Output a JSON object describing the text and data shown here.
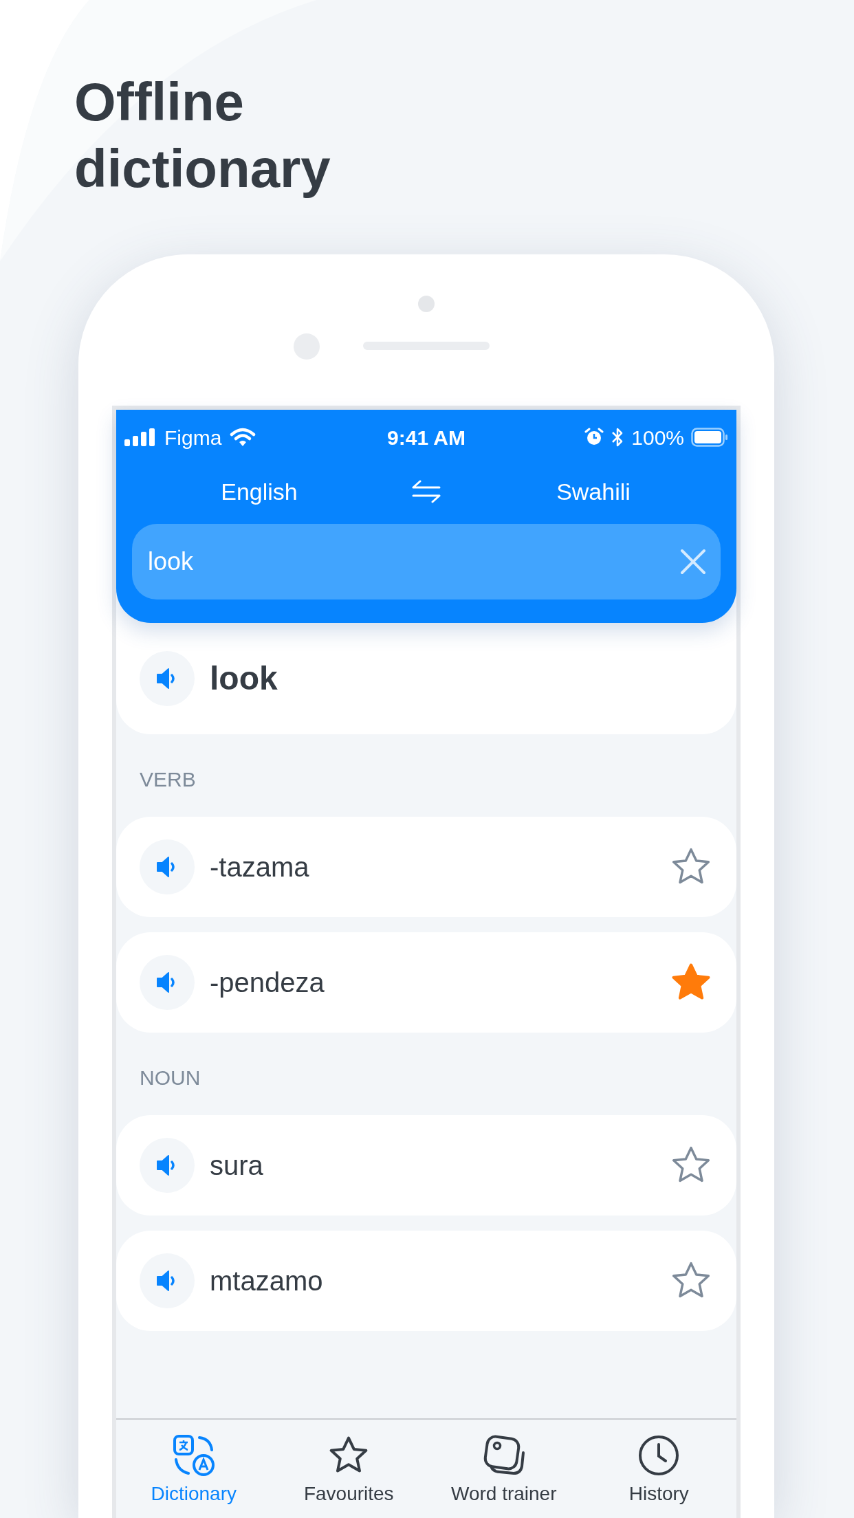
{
  "heading": "Offline dictionary",
  "status_bar": {
    "carrier": "Figma",
    "time": "9:41 AM",
    "battery": "100%"
  },
  "languages": {
    "source": "English",
    "target": "Swahili"
  },
  "search": {
    "value": "look"
  },
  "headword": "look",
  "sections": [
    {
      "title": "VERB",
      "entries": [
        {
          "word": "-tazama",
          "favourite": false
        },
        {
          "word": "-pendeza",
          "favourite": true
        }
      ]
    },
    {
      "title": "NOUN",
      "entries": [
        {
          "word": "sura",
          "favourite": false
        },
        {
          "word": "mtazamo",
          "favourite": false
        }
      ]
    }
  ],
  "tabs": [
    {
      "label": "Dictionary",
      "kind": "dictionary",
      "selected": true
    },
    {
      "label": "Favourites",
      "kind": "favourites",
      "selected": false
    },
    {
      "label": "Word trainer",
      "kind": "trainer",
      "selected": false
    },
    {
      "label": "History",
      "kind": "history",
      "selected": false
    }
  ]
}
